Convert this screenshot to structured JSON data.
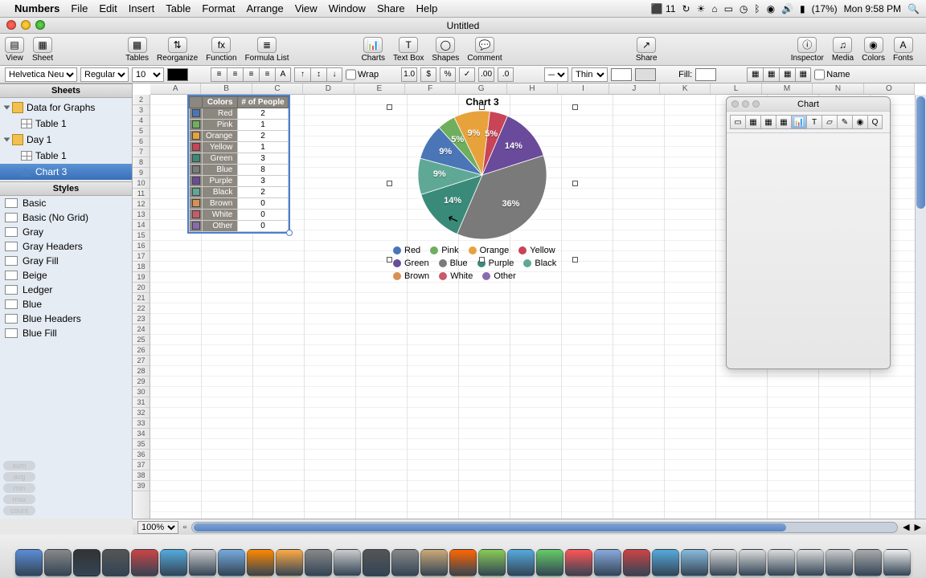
{
  "menubar": {
    "app": "Numbers",
    "items": [
      "File",
      "Edit",
      "Insert",
      "Table",
      "Format",
      "Arrange",
      "View",
      "Window",
      "Share",
      "Help"
    ],
    "right": {
      "adobe": "11",
      "battery": "(17%)",
      "clock": "Mon 9:58 PM"
    }
  },
  "window": {
    "title": "Untitled"
  },
  "toolbar": {
    "left": [
      {
        "label": "View",
        "glyph": "▤"
      },
      {
        "label": "Sheet",
        "glyph": "▦"
      }
    ],
    "mid": [
      {
        "label": "Tables",
        "glyph": "▦"
      },
      {
        "label": "Reorganize",
        "glyph": "⇅"
      },
      {
        "label": "Function",
        "glyph": "fx"
      },
      {
        "label": "Formula List",
        "glyph": "≣"
      }
    ],
    "mid2": [
      {
        "label": "Charts",
        "glyph": "📊"
      },
      {
        "label": "Text Box",
        "glyph": "T"
      },
      {
        "label": "Shapes",
        "glyph": "◯"
      },
      {
        "label": "Comment",
        "glyph": "💬"
      }
    ],
    "share": {
      "label": "Share",
      "glyph": "↗"
    },
    "right": [
      {
        "label": "Inspector",
        "glyph": "ⓘ"
      },
      {
        "label": "Media",
        "glyph": "♫"
      },
      {
        "label": "Colors",
        "glyph": "◉"
      },
      {
        "label": "Fonts",
        "glyph": "A"
      }
    ]
  },
  "fmtbar": {
    "font": "Helvetica Neue",
    "style": "Regular",
    "size": "10",
    "wrap": "Wrap",
    "border": "Thin",
    "fill": "Fill:",
    "name": "Name",
    "num": "1.0"
  },
  "sidebar": {
    "hdr_sheets": "Sheets",
    "hdr_styles": "Styles",
    "tree": [
      {
        "type": "sheet",
        "label": "Data for Graphs",
        "exp": true
      },
      {
        "type": "table",
        "label": "Table 1"
      },
      {
        "type": "sheet",
        "label": "Day 1",
        "exp": true
      },
      {
        "type": "table",
        "label": "Table 1"
      },
      {
        "type": "chart",
        "label": "Chart 3",
        "sel": true
      }
    ],
    "styles": [
      "Basic",
      "Basic (No Grid)",
      "Gray",
      "Gray Headers",
      "Gray Fill",
      "Beige",
      "Ledger",
      "Blue",
      "Blue Headers",
      "Blue Fill"
    ],
    "footpills": [
      "sum",
      "avg",
      "min",
      "max",
      "count"
    ]
  },
  "cols": [
    "A",
    "B",
    "C",
    "D",
    "E",
    "F",
    "G",
    "H",
    "I",
    "J",
    "K",
    "L",
    "M",
    "N",
    "O"
  ],
  "table": {
    "hdr_a": "Colors",
    "hdr_b": "# of People",
    "rows": [
      {
        "c": "#4a76b8",
        "n": "Red",
        "v": "2"
      },
      {
        "c": "#6fae5d",
        "n": "Pink",
        "v": "1"
      },
      {
        "c": "#e8a23c",
        "n": "Orange",
        "v": "2"
      },
      {
        "c": "#c84456",
        "n": "Yellow",
        "v": "1"
      },
      {
        "c": "#3a8a7a",
        "n": "Green",
        "v": "3"
      },
      {
        "c": "#7a7a7a",
        "n": "Blue",
        "v": "8"
      },
      {
        "c": "#6a4a9a",
        "n": "Purple",
        "v": "3"
      },
      {
        "c": "#5fa896",
        "n": "Black",
        "v": "2"
      },
      {
        "c": "#d89050",
        "n": "Brown",
        "v": "0"
      },
      {
        "c": "#c85a6a",
        "n": "White",
        "v": "0"
      },
      {
        "c": "#8a6ab0",
        "n": "Other",
        "v": "0"
      }
    ]
  },
  "chart_data": {
    "type": "pie",
    "title": "Chart 3",
    "series": [
      {
        "name": "Red",
        "value": 2,
        "pct": "9%",
        "color": "#4a76b8"
      },
      {
        "name": "Pink",
        "value": 1,
        "pct": "5%",
        "color": "#6fae5d"
      },
      {
        "name": "Orange",
        "value": 2,
        "pct": "9%",
        "color": "#e8a23c"
      },
      {
        "name": "Yellow",
        "value": 1,
        "pct": "5%",
        "color": "#c84456"
      },
      {
        "name": "Green",
        "value": 3,
        "pct": "14%",
        "color": "#6a4a9a"
      },
      {
        "name": "Blue",
        "value": 8,
        "pct": "36%",
        "color": "#7a7a7a"
      },
      {
        "name": "Purple",
        "value": 3,
        "pct": "14%",
        "color": "#3a8a7a"
      },
      {
        "name": "Black",
        "value": 2,
        "pct": "9%",
        "color": "#5fa896"
      },
      {
        "name": "Brown",
        "value": 0,
        "pct": "",
        "color": "#d89050"
      },
      {
        "name": "White",
        "value": 0,
        "pct": "",
        "color": "#c85a6a"
      },
      {
        "name": "Other",
        "value": 0,
        "pct": "",
        "color": "#8a6ab0"
      }
    ]
  },
  "inspector": {
    "title": "Chart"
  },
  "status": {
    "zoom": "100%"
  }
}
